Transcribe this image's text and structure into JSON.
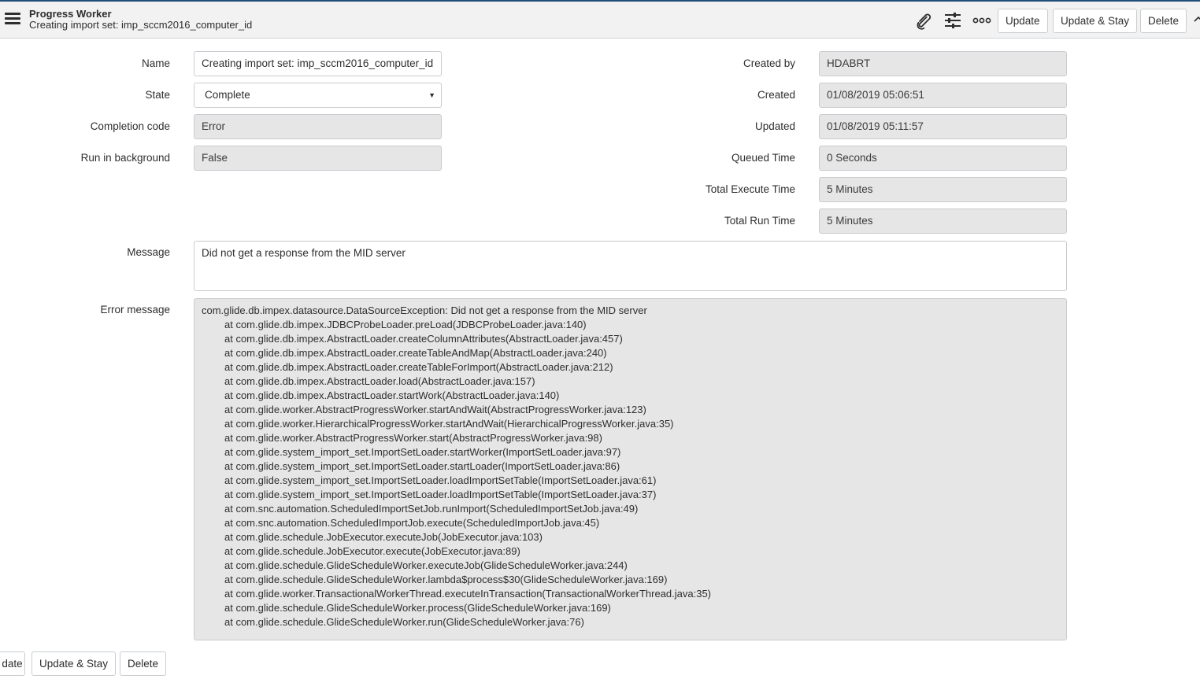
{
  "header": {
    "title": "Progress Worker",
    "subtitle": "Creating import set: imp_sccm2016_computer_id",
    "icons": [
      "menu-icon",
      "paperclip-icon",
      "sliders-icon",
      "more-options-icon"
    ],
    "buttons": {
      "update": "Update",
      "update_stay": "Update & Stay",
      "delete": "Delete"
    }
  },
  "form": {
    "name_label": "Name",
    "name_value": "Creating import set: imp_sccm2016_computer_id",
    "state_label": "State",
    "state_value": "Complete",
    "completion_code_label": "Completion code",
    "completion_code_value": "Error",
    "run_bg_label": "Run in background",
    "run_bg_value": "False",
    "created_by_label": "Created by",
    "created_by_value": "HDABRT",
    "created_label": "Created",
    "created_value": "01/08/2019 05:06:51",
    "updated_label": "Updated",
    "updated_value": "01/08/2019 05:11:57",
    "queued_label": "Queued Time",
    "queued_value": "0 Seconds",
    "exec_label": "Total Execute Time",
    "exec_value": "5 Minutes",
    "run_label": "Total Run Time",
    "run_value": "5 Minutes",
    "message_label": "Message",
    "message_value": "Did not get a response from the MID server",
    "error_label": "Error message",
    "error_lines": [
      "com.glide.db.impex.datasource.DataSourceException: Did not get a response from the MID server",
      "at com.glide.db.impex.JDBCProbeLoader.preLoad(JDBCProbeLoader.java:140)",
      "at com.glide.db.impex.AbstractLoader.createColumnAttributes(AbstractLoader.java:457)",
      "at com.glide.db.impex.AbstractLoader.createTableAndMap(AbstractLoader.java:240)",
      "at com.glide.db.impex.AbstractLoader.createTableForImport(AbstractLoader.java:212)",
      "at com.glide.db.impex.AbstractLoader.load(AbstractLoader.java:157)",
      "at com.glide.db.impex.AbstractLoader.startWork(AbstractLoader.java:140)",
      "at com.glide.worker.AbstractProgressWorker.startAndWait(AbstractProgressWorker.java:123)",
      "at com.glide.worker.HierarchicalProgressWorker.startAndWait(HierarchicalProgressWorker.java:35)",
      "at com.glide.worker.AbstractProgressWorker.start(AbstractProgressWorker.java:98)",
      "at com.glide.system_import_set.ImportSetLoader.startWorker(ImportSetLoader.java:97)",
      "at com.glide.system_import_set.ImportSetLoader.startLoader(ImportSetLoader.java:86)",
      "at com.glide.system_import_set.ImportSetLoader.loadImportSetTable(ImportSetLoader.java:61)",
      "at com.glide.system_import_set.ImportSetLoader.loadImportSetTable(ImportSetLoader.java:37)",
      "at com.snc.automation.ScheduledImportSetJob.runImport(ScheduledImportSetJob.java:49)",
      "at com.snc.automation.ScheduledImportJob.execute(ScheduledImportJob.java:45)",
      "at com.glide.schedule.JobExecutor.executeJob(JobExecutor.java:103)",
      "at com.glide.schedule.JobExecutor.execute(JobExecutor.java:89)",
      "at com.glide.schedule.GlideScheduleWorker.executeJob(GlideScheduleWorker.java:244)",
      "at com.glide.schedule.GlideScheduleWorker.lambda$process$30(GlideScheduleWorker.java:169)",
      "at com.glide.worker.TransactionalWorkerThread.executeInTransaction(TransactionalWorkerThread.java:35)",
      "at com.glide.schedule.GlideScheduleWorker.process(GlideScheduleWorker.java:169)",
      "at com.glide.schedule.GlideScheduleWorker.run(GlideScheduleWorker.java:76)"
    ]
  },
  "footer": {
    "update_partial": "date",
    "update_stay": "Update & Stay",
    "delete": "Delete"
  }
}
